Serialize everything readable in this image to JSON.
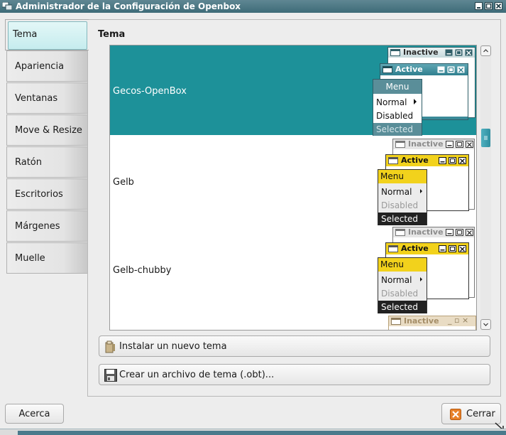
{
  "window": {
    "title": "Administrador de la Configuración de Openbox"
  },
  "tabs": [
    {
      "label": "Tema"
    },
    {
      "label": "Apariencia"
    },
    {
      "label": "Ventanas"
    },
    {
      "label": "Move & Resize"
    },
    {
      "label": "Ratón"
    },
    {
      "label": "Escritorios"
    },
    {
      "label": "Márgenes"
    },
    {
      "label": "Muelle"
    }
  ],
  "section": {
    "title": "Tema"
  },
  "themes": [
    {
      "name": "Gecos-OpenBox",
      "selected": true
    },
    {
      "name": "Gelb",
      "selected": false
    },
    {
      "name": "Gelb-chubby",
      "selected": false
    }
  ],
  "preview": {
    "inactive": "Inactive",
    "active": "Active",
    "menu": "Menu",
    "normal": "Normal",
    "disabled": "Disabled",
    "selected": "Selected"
  },
  "actions": {
    "install": "Instalar un nuevo tema",
    "create": "Crear un archivo de tema (.obt)..."
  },
  "footer": {
    "about": "Acerca",
    "close": "Cerrar"
  },
  "colors": {
    "accent": "#1d9199",
    "titlebar": "#4a7a86",
    "gelb": "#f2d21c"
  }
}
